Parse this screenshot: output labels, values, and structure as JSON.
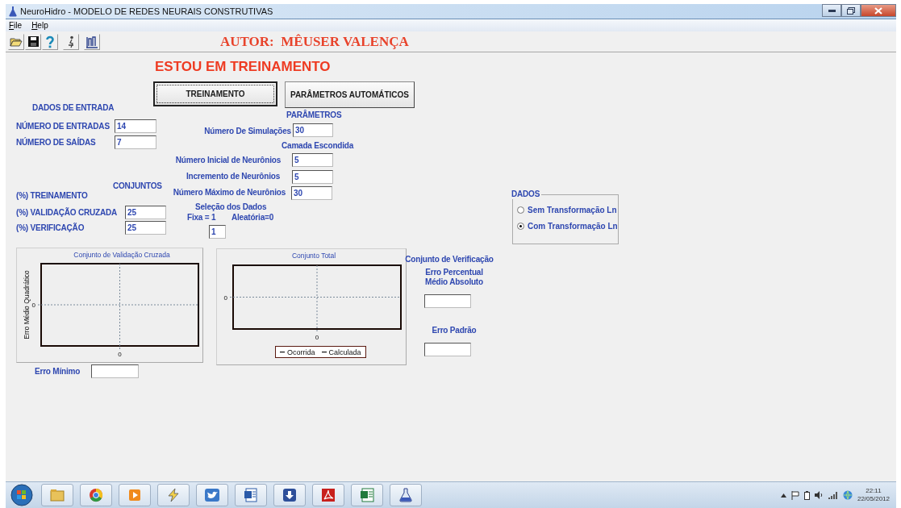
{
  "window": {
    "title": "NeuroHidro - MODELO DE REDES NEURAIS CONSTRUTIVAS"
  },
  "menu": [
    {
      "label": "File"
    },
    {
      "label": "Help"
    }
  ],
  "author": "AUTOR:  MÊUSER VALENÇA",
  "status": "ESTOU EM TREINAMENTO",
  "buttons": [
    {
      "label": "TREINAMENTO",
      "focused": true
    },
    {
      "label": "PARÂMETROS AUTOMÁTICOS",
      "focused": false
    }
  ],
  "dados_de_entrada": {
    "title": "DADOS DE ENTRADA",
    "fields": [
      {
        "label": "NÚMERO DE ENTRADAS",
        "value": "14"
      },
      {
        "label": "NÚMERO DE SAÍDAS",
        "value": "7"
      }
    ]
  },
  "parametros": {
    "title": "PARÂMETROS",
    "simulacoes": {
      "label": "Número De Simulações",
      "value": "30"
    },
    "camada_escondida": {
      "title": "Camada Escondida",
      "fields": [
        {
          "label": "Número Inicial de Neurônios",
          "value": "5"
        },
        {
          "label": "Incremento de Neurônios",
          "value": "5"
        },
        {
          "label": "Número Máximo de Neurônios",
          "value": "30"
        }
      ]
    }
  },
  "conjuntos": {
    "title": "CONJUNTOS",
    "fields": [
      {
        "label": "(%) TREINAMENTO"
      },
      {
        "label": "(%) VALIDAÇÃO CRUZADA",
        "value": "25"
      },
      {
        "label": "(%) VERIFICAÇÃO",
        "value": "25"
      }
    ]
  },
  "selecao_dos_dados": {
    "title": "Seleção dos Dados",
    "fixa": "Fixa = 1",
    "aleatoria": "Aleatória=0",
    "value": "1"
  },
  "dados": {
    "title": "DADOS",
    "options": [
      {
        "label": "Sem Transformação Ln",
        "selected": false
      },
      {
        "label": "Com Transformação Ln",
        "selected": true
      }
    ]
  },
  "charts": [
    {
      "title": "Conjunto de Validação Cruzada",
      "ylabel": "Erro Médio Quadrático",
      "x_tick": "0",
      "y_tick": "0"
    },
    {
      "title": "Conjunto Total",
      "x_tick": "0",
      "y_tick": "0",
      "legend": [
        "Ocorrida",
        "Calculada"
      ]
    }
  ],
  "conjunto_de_verificacao": {
    "title": "Conjunto de Verificação",
    "erro_percentual": {
      "label": "Erro Percentual\nMédio Absoluto"
    },
    "erro_padrao": {
      "label": "Erro Padrão"
    }
  },
  "erro_minimo": {
    "label": "Erro Mínimo"
  },
  "taskbar": {
    "time": "22:11",
    "date": "22/05/2012"
  }
}
